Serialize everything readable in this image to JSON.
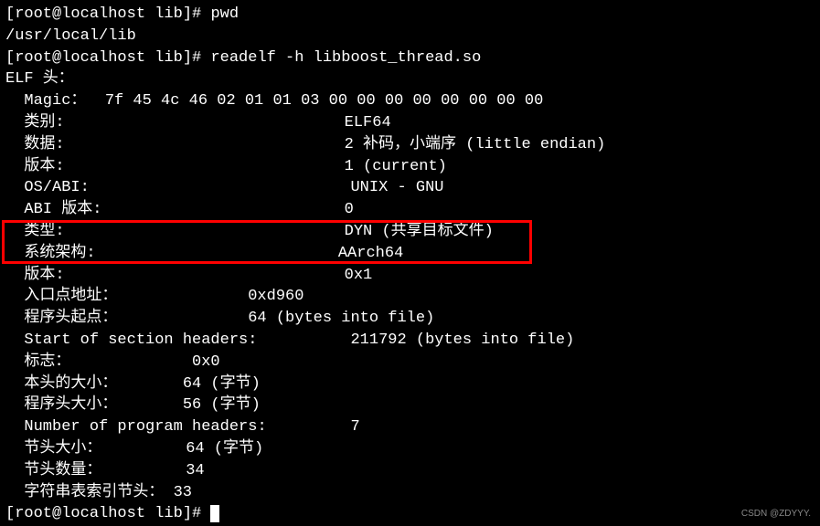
{
  "prompt1": "[root@localhost lib]# ",
  "cmd1": "pwd",
  "pwd_output": "/usr/local/lib",
  "prompt2": "[root@localhost lib]# ",
  "cmd2": "readelf -h libboost_thread.so",
  "elf_header": "ELF 头：",
  "fields": {
    "magic_label": "  Magic：  ",
    "magic_value": "7f 45 4c 46 02 01 01 03 00 00 00 00 00 00 00 00 ",
    "class_label": "  类别:                              ",
    "class_value": "ELF64",
    "data_label": "  数据:                              ",
    "data_value": "2 补码，小端序 (little endian)",
    "version_label": "  版本:                              ",
    "version_value": "1 (current)",
    "osabi_label": "  OS/ABI:                            ",
    "osabi_value": "UNIX - GNU",
    "abiver_label": "  ABI 版本:                          ",
    "abiver_value": "0",
    "type_label": "  类型:                              ",
    "type_value": "DYN (共享目标文件)",
    "machine_label": "  系统架构:                          ",
    "machine_value": "AArch64",
    "ver2_label": "  版本:                              ",
    "ver2_value": "0x1",
    "entry_label": "  入口点地址：              ",
    "entry_value": "0xd960",
    "phoff_label": "  程序头起点：              ",
    "phoff_value": "64 (bytes into file)",
    "shoff_label": "  Start of section headers:          ",
    "shoff_value": "211792 (bytes into file)",
    "flags_label": "  标志：             ",
    "flags_value": "0x0",
    "ehsize_label": "  本头的大小：       ",
    "ehsize_value": "64 (字节)",
    "phsize_label": "  程序头大小：       ",
    "phsize_value": "56 (字节)",
    "phnum_label": "  Number of program headers:         ",
    "phnum_value": "7",
    "shsize_label": "  节头大小：         ",
    "shsize_value": "64 (字节)",
    "shnum_label": "  节头数量：         ",
    "shnum_value": "34",
    "shstrndx_label": "  字符串表索引节头： ",
    "shstrndx_value": "33"
  },
  "prompt3": "[root@localhost lib]# ",
  "watermark": "CSDN @ZDYYY."
}
